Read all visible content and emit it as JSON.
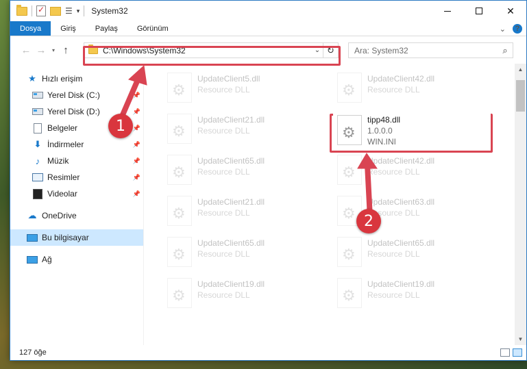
{
  "window": {
    "title": "System32",
    "controls": {
      "minimize_icon": "minimize-icon",
      "maximize_icon": "maximize-icon",
      "close_label": "✕"
    }
  },
  "quick_access_toolbar": {
    "down_arrow": "▾"
  },
  "ribbon": {
    "tabs": [
      {
        "label": "Dosya",
        "active": true
      },
      {
        "label": "Giriş"
      },
      {
        "label": "Paylaş"
      },
      {
        "label": "Görünüm"
      }
    ],
    "expand_glyph": "⌄",
    "help_glyph": "?"
  },
  "nav": {
    "back_glyph": "←",
    "forward_glyph": "→",
    "recent_glyph": "▾",
    "up_glyph": "↑",
    "address": "C:\\Windows\\System32",
    "address_dropdown_glyph": "⌄",
    "refresh_glyph": "↻",
    "search_placeholder": "Ara: System32",
    "search_glyph": "⌕"
  },
  "sidebar": {
    "quick_access": {
      "label": "Hızlı erişim",
      "icon": "star-icon"
    },
    "pinned": [
      {
        "label": "Yerel Disk (C:)",
        "icon": "drive-icon"
      },
      {
        "label": "Yerel Disk (D:)",
        "icon": "drive-icon"
      },
      {
        "label": "Belgeler",
        "icon": "documents-icon"
      },
      {
        "label": "İndirmeler",
        "icon": "downloads-icon"
      },
      {
        "label": "Müzik",
        "icon": "music-icon"
      },
      {
        "label": "Resimler",
        "icon": "pictures-icon"
      },
      {
        "label": "Videolar",
        "icon": "videos-icon"
      }
    ],
    "onedrive": {
      "label": "OneDrive",
      "icon": "cloud-icon"
    },
    "this_pc": {
      "label": "Bu bilgisayar",
      "icon": "computer-icon",
      "selected": true
    },
    "network": {
      "label": "Ağ",
      "icon": "network-icon"
    }
  },
  "files": {
    "left_column": [
      {
        "name": "UpdateClient5.dll",
        "type": "Resource DLL"
      },
      {
        "name": "UpdateClient21.dll",
        "type": "Resource DLL"
      },
      {
        "name": "UpdateClient65.dll",
        "type": "Resource DLL"
      },
      {
        "name": "UpdateClient21.dll",
        "type": "Resource DLL"
      },
      {
        "name": "UpdateClient65.dll",
        "type": "Resource DLL"
      },
      {
        "name": "UpdateClient19.dll",
        "type": "Resource DLL"
      }
    ],
    "right_column": [
      {
        "name": "UpdateClient42.dll",
        "type": "Resource DLL"
      },
      {
        "name": "UpdateClient42.dll",
        "type": "Resource DLL"
      },
      {
        "name": "UpdateClient63.dll",
        "type": "Resource DLL"
      },
      {
        "name": "UpdateClient65.dll",
        "type": "Resource DLL"
      },
      {
        "name": "UpdateClient19.dll",
        "type": "Resource DLL"
      }
    ],
    "highlighted": {
      "name": "tipp48.dll",
      "version": "1.0.0.0",
      "description": "WIN.INI"
    }
  },
  "statusbar": {
    "item_count": "127 öğe"
  },
  "annotations": {
    "step1": "1",
    "step2": "2",
    "color": "#d94452"
  }
}
